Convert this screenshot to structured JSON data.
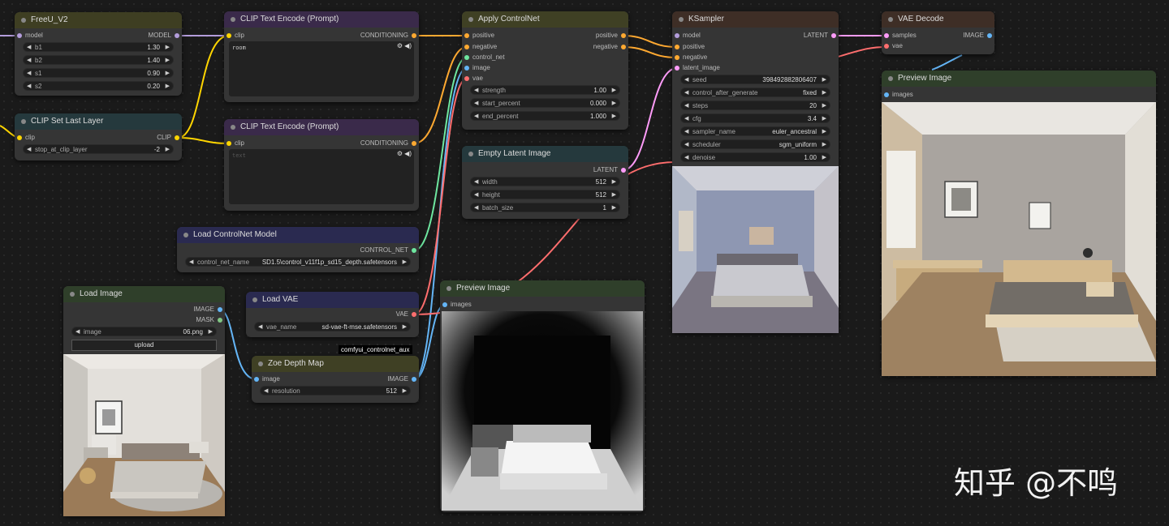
{
  "nodes": {
    "freeu": {
      "title": "FreeU_V2",
      "in_model": "model",
      "out_model": "MODEL",
      "widgets": [
        {
          "label": "b1",
          "value": "1.30"
        },
        {
          "label": "b2",
          "value": "1.40"
        },
        {
          "label": "s1",
          "value": "0.90"
        },
        {
          "label": "s2",
          "value": "0.20"
        }
      ]
    },
    "clip_set": {
      "title": "CLIP Set Last Layer",
      "in_clip": "clip",
      "out_clip": "CLIP",
      "widget": {
        "label": "stop_at_clip_layer",
        "value": "-2"
      }
    },
    "clip_pos": {
      "title": "CLIP Text Encode (Prompt)",
      "in_clip": "clip",
      "out": "CONDITIONING",
      "text": "room"
    },
    "clip_neg": {
      "title": "CLIP Text Encode (Prompt)",
      "in_clip": "clip",
      "out": "CONDITIONING",
      "placeholder": "text"
    },
    "load_cn": {
      "title": "Load ControlNet Model",
      "out": "CONTROL_NET",
      "widget": {
        "label": "control_net_name",
        "value": "SD1.5\\control_v11f1p_sd15_depth.safetensors"
      }
    },
    "load_image": {
      "title": "Load Image",
      "out_image": "IMAGE",
      "out_mask": "MASK",
      "widget": {
        "label": "image",
        "value": "06.png"
      },
      "upload": "upload"
    },
    "load_vae": {
      "title": "Load VAE",
      "out": "VAE",
      "widget": {
        "label": "vae_name",
        "value": "sd-vae-ft-mse.safetensors"
      }
    },
    "aux_badge": "comfyui_controlnet_aux",
    "zoe": {
      "title": "Zoe Depth Map",
      "in_image": "image",
      "out": "IMAGE",
      "widget": {
        "label": "resolution",
        "value": "512"
      }
    },
    "apply_cn": {
      "title": "Apply ControlNet",
      "inputs": [
        "positive",
        "negative",
        "control_net",
        "image",
        "vae"
      ],
      "outputs": [
        "positive",
        "negative"
      ],
      "widgets": [
        {
          "label": "strength",
          "value": "1.00"
        },
        {
          "label": "start_percent",
          "value": "0.000"
        },
        {
          "label": "end_percent",
          "value": "1.000"
        }
      ]
    },
    "empty_latent": {
      "title": "Empty Latent Image",
      "out": "LATENT",
      "widgets": [
        {
          "label": "width",
          "value": "512"
        },
        {
          "label": "height",
          "value": "512"
        },
        {
          "label": "batch_size",
          "value": "1"
        }
      ]
    },
    "preview_depth": {
      "title": "Preview Image",
      "in_images": "images"
    },
    "ksampler": {
      "title": "KSampler",
      "inputs": [
        "model",
        "positive",
        "negative",
        "latent_image"
      ],
      "out": "LATENT",
      "widgets": [
        {
          "label": "seed",
          "value": "398492882806407"
        },
        {
          "label": "control_after_generate",
          "value": "fixed"
        },
        {
          "label": "steps",
          "value": "20"
        },
        {
          "label": "cfg",
          "value": "3.4"
        },
        {
          "label": "sampler_name",
          "value": "euler_ancestral"
        },
        {
          "label": "scheduler",
          "value": "sgm_uniform"
        },
        {
          "label": "denoise",
          "value": "1.00"
        }
      ]
    },
    "vae_decode": {
      "title": "VAE Decode",
      "in_samples": "samples",
      "in_vae": "vae",
      "out": "IMAGE"
    },
    "preview_final": {
      "title": "Preview Image",
      "in_images": "images"
    }
  },
  "watermark": "知乎 @不鸣",
  "colors": {
    "model": "#b39ddb",
    "clip": "#ffd500",
    "conditioning": "#ffa931",
    "control_net": "#6ee7a0",
    "image": "#64b5f6",
    "vae": "#ff6e6e",
    "latent": "#ff9cf9"
  }
}
